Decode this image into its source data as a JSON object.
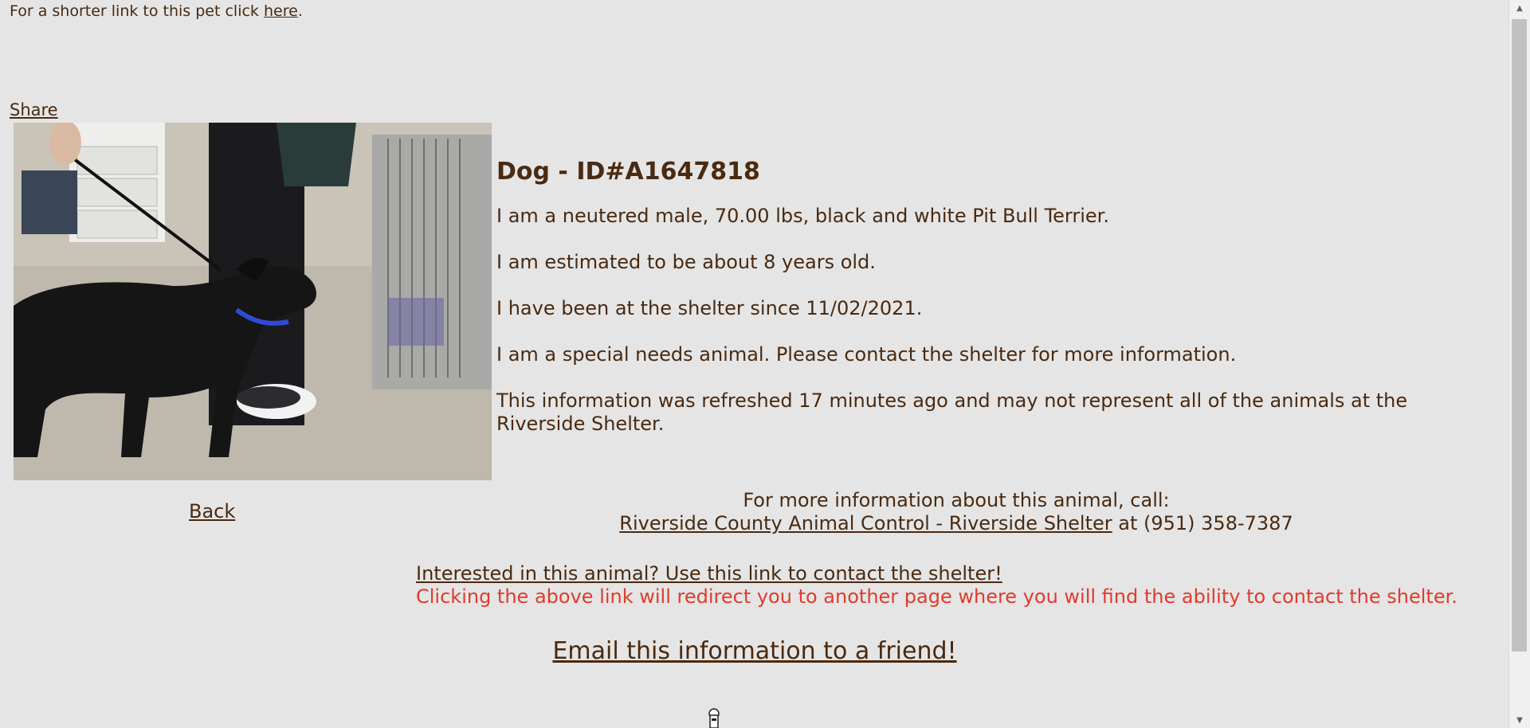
{
  "top": {
    "prefix": "For a shorter link to this pet click ",
    "link_label": "here",
    "suffix": "."
  },
  "share_label": "Share",
  "back_label": "Back",
  "animal": {
    "title": "Dog - ID#A1647818",
    "lines": [
      "I am a neutered male, 70.00 lbs, black and white Pit Bull Terrier.",
      "I am estimated to be about 8 years old.",
      "I have been at the shelter since 11/02/2021.",
      "I am a special needs animal. Please contact the shelter for more information.",
      "This information was refreshed 17 minutes ago and may not represent all of the animals at the Riverside Shelter."
    ]
  },
  "contact": {
    "lead": "For more information about this animal, call:",
    "shelter_link": "Riverside County Animal Control - Riverside Shelter",
    "phone_text": " at (951) 358-7387"
  },
  "interest": {
    "link_label": "Interested in this animal? Use this link to contact the shelter!",
    "note": "Clicking the above link will redirect you to another page where you will find the ability to contact the shelter."
  },
  "email_label": "Email this information to a friend!",
  "colors": {
    "background": "#e5e5e5",
    "text": "#4a2a10",
    "alert": "#e03b2c"
  }
}
